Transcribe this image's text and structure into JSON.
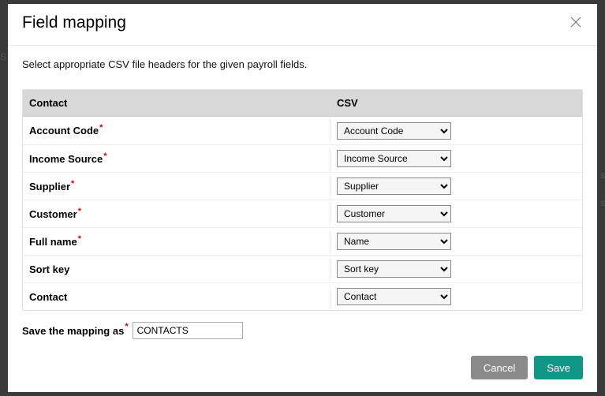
{
  "modal": {
    "title": "Field mapping",
    "instruction": "Select appropriate CSV file headers for the given payroll fields.",
    "columns": {
      "left": "Contact",
      "right": "CSV"
    },
    "rows": [
      {
        "label": "Account Code",
        "required": true,
        "value": "Account Code"
      },
      {
        "label": "Income Source",
        "required": true,
        "value": "Income Source"
      },
      {
        "label": "Supplier",
        "required": true,
        "value": "Supplier"
      },
      {
        "label": "Customer",
        "required": true,
        "value": "Customer"
      },
      {
        "label": "Full name",
        "required": true,
        "value": "Name"
      },
      {
        "label": "Sort key",
        "required": false,
        "value": "Sort key"
      },
      {
        "label": "Contact",
        "required": false,
        "value": "Contact"
      }
    ],
    "save_as_label": "Save the mapping as",
    "save_as_value": "CONTACTS",
    "buttons": {
      "cancel": "Cancel",
      "save": "Save"
    }
  },
  "required_marker": "*"
}
